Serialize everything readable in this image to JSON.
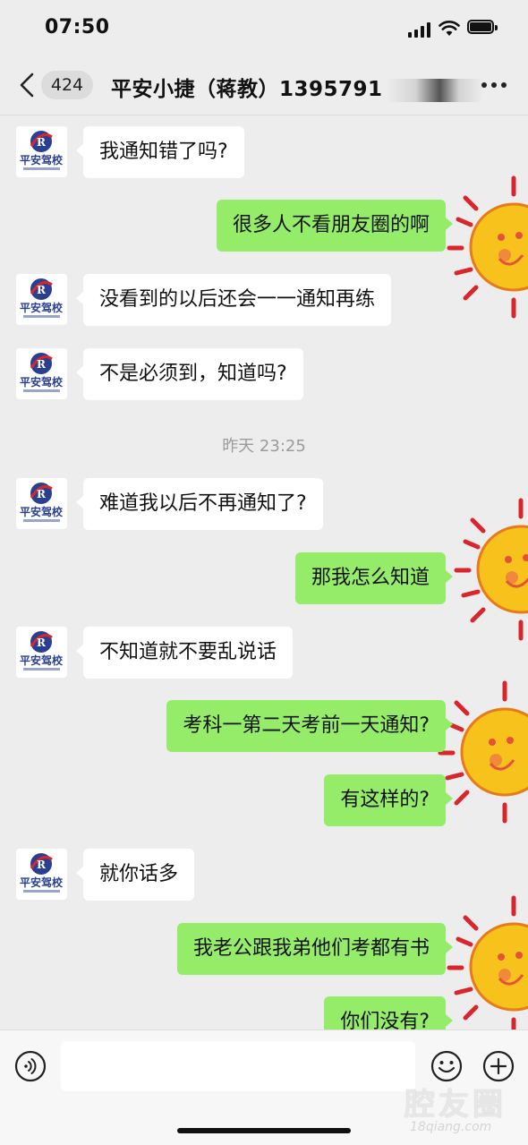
{
  "status_bar": {
    "time": "07:50"
  },
  "header": {
    "unread_count": "424",
    "title": "平安小捷（蒋教）1395791"
  },
  "messages": [
    {
      "side": "in",
      "text": "我通知错了吗?"
    },
    {
      "side": "out",
      "text": "很多人不看朋友圈的啊"
    },
    {
      "side": "in",
      "text": "没看到的以后还会一一通知再练"
    },
    {
      "side": "in",
      "text": "不是必须到，知道吗?"
    },
    {
      "side": "time",
      "text": "昨天 23:25"
    },
    {
      "side": "in",
      "text": "难道我以后不再通知了?"
    },
    {
      "side": "out",
      "text": "那我怎么知道"
    },
    {
      "side": "in",
      "text": "不知道就不要乱说话"
    },
    {
      "side": "out",
      "text": "考科一第二天考前一天通知?"
    },
    {
      "side": "out",
      "text": "有这样的?"
    },
    {
      "side": "in",
      "text": "就你话多"
    },
    {
      "side": "out",
      "text": "我老公跟我弟他们考都有书"
    },
    {
      "side": "out",
      "text": "你们没有?"
    }
  ],
  "avatar": {
    "brand": "平安驾校",
    "sub": "PINGAN DRIVING SCHOOL",
    "color": "#2a3f8f",
    "accent": "#d8262c"
  },
  "composer": {
    "value": "",
    "placeholder": ""
  },
  "watermark": {
    "big": "腔友圈",
    "small": "18qiang.com"
  },
  "icons": [
    "back-chevron-icon",
    "more-icon",
    "voice-icon",
    "emoji-icon",
    "plus-icon"
  ],
  "colors": {
    "outgoing": "#95ec69",
    "incoming": "#ffffff",
    "background": "#ededed"
  }
}
